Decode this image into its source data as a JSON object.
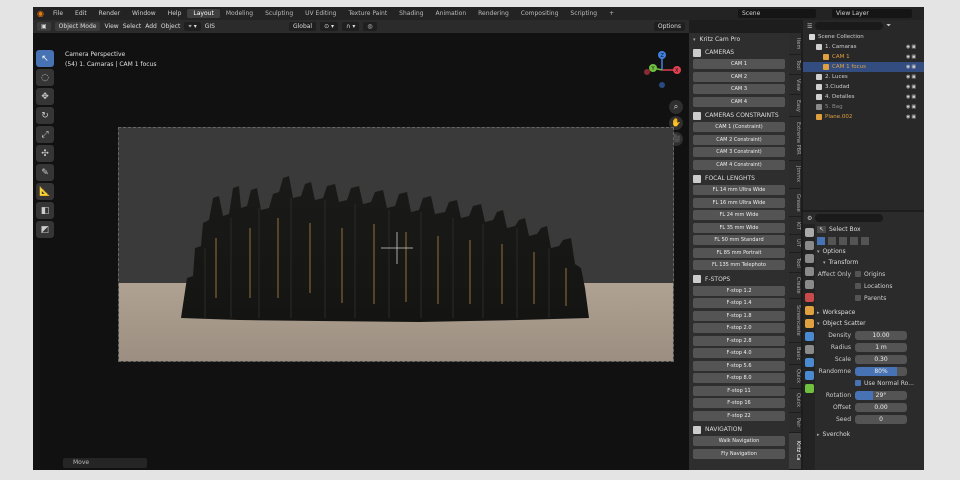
{
  "menubar": {
    "items": [
      "File",
      "Edit",
      "Render",
      "Window",
      "Help"
    ],
    "workspaces": [
      "Layout",
      "Modeling",
      "Sculpting",
      "UV Editing",
      "Texture Paint",
      "Shading",
      "Animation",
      "Rendering",
      "Compositing",
      "Scripting",
      "+"
    ],
    "active_workspace": "Layout",
    "scene": "Scene",
    "view_layer": "View Layer"
  },
  "viewport": {
    "mode": "Object Mode",
    "menus": [
      "View",
      "Select",
      "Add",
      "Object"
    ],
    "gis": "GIS",
    "orientation": "Global",
    "options": "Options",
    "info_line1": "Camera Perspective",
    "info_line2": "(54) 1. Camaras | CAM 1 focus",
    "status": "Move"
  },
  "gizmo": {
    "x": "X",
    "y": "Y",
    "z": "Z"
  },
  "npanel": {
    "title": "Kritz Cam Pro",
    "cameras_header": "CAMERAS",
    "cameras": [
      "CAM 1",
      "CAM 2",
      "CAM 3",
      "CAM 4"
    ],
    "constraints_header": "CAMERAS CONSTRAINTS",
    "constraints": [
      "CAM 1 (Constraint)",
      "CAM 2 Constraint)",
      "CAM 3 Constraint)",
      "CAM 4 Constraint)"
    ],
    "focal_header": "FOCAL LENGHTS",
    "focal": [
      "FL 14 mm Ultra Wide",
      "FL 16 mm Ultra Wide",
      "FL 24 mm Wide",
      "FL 35 mm Wide",
      "FL 50 mm Standard",
      "FL 85 mm Portrait",
      "FL 135 mm Telephoto"
    ],
    "fstops_header": "F-STOPS",
    "fstops": [
      "F-stop 1.2",
      "F-stop 1.4",
      "F-stop 1.8",
      "F-stop 2.0",
      "F-stop 2.8",
      "F-stop 4.0",
      "F-stop 5.6",
      "F-stop 8.0",
      "F-stop 11",
      "F-stop 16",
      "F-stop 22"
    ],
    "navigation_header": "NAVIGATION",
    "navigation": [
      "Walk Navigation",
      "Fly Navigation"
    ]
  },
  "tabs": [
    "Item",
    "Tool",
    "View",
    "Easy",
    "Extreme PBR",
    "Jtmmx",
    "Grease",
    "KIT",
    "UiT",
    "Tool",
    "Create",
    "Screencaste",
    "Basic",
    "Quick",
    "Quick",
    "Pair",
    "Kritz Ca"
  ],
  "outliner": {
    "root": "Scene Collection",
    "rows": [
      {
        "name": "1. Camaras",
        "indent": 1,
        "color": "#d0d0d0"
      },
      {
        "name": "CAM 1",
        "indent": 2,
        "color": "#e0a040"
      },
      {
        "name": "CAM 1 focus",
        "indent": 2,
        "color": "#e0a040",
        "selected": true
      },
      {
        "name": "2. Luces",
        "indent": 1,
        "color": "#d0d0d0"
      },
      {
        "name": "3.Ciudad",
        "indent": 1,
        "color": "#d0d0d0"
      },
      {
        "name": "4. Detalles",
        "indent": 1,
        "color": "#d0d0d0"
      },
      {
        "name": "5. Bag",
        "indent": 1,
        "color": "#8a8a8a"
      },
      {
        "name": "Plane.002",
        "indent": 1,
        "color": "#e0a040"
      }
    ]
  },
  "properties": {
    "tool": "Select Box",
    "options": "Options",
    "transform": "Transform",
    "affect_only": "Affect Only",
    "checks": [
      "Origins",
      "Locations",
      "Parents"
    ],
    "workspace": "Workspace",
    "object_scatter": "Object Scatter",
    "fields": [
      {
        "label": "Density",
        "value": "10.00"
      },
      {
        "label": "Radius",
        "value": "1 m"
      },
      {
        "label": "Scale",
        "value": "0.30"
      },
      {
        "label": "Randomne",
        "value": "80%",
        "fill": 0.8
      }
    ],
    "use_normal": "Use Normal Ro...",
    "fields2": [
      {
        "label": "Rotation",
        "value": "29°",
        "fill": 0.35
      },
      {
        "label": "Offset",
        "value": "0.00"
      },
      {
        "label": "Seed",
        "value": "0"
      }
    ],
    "sverchok": "Sverchok"
  }
}
